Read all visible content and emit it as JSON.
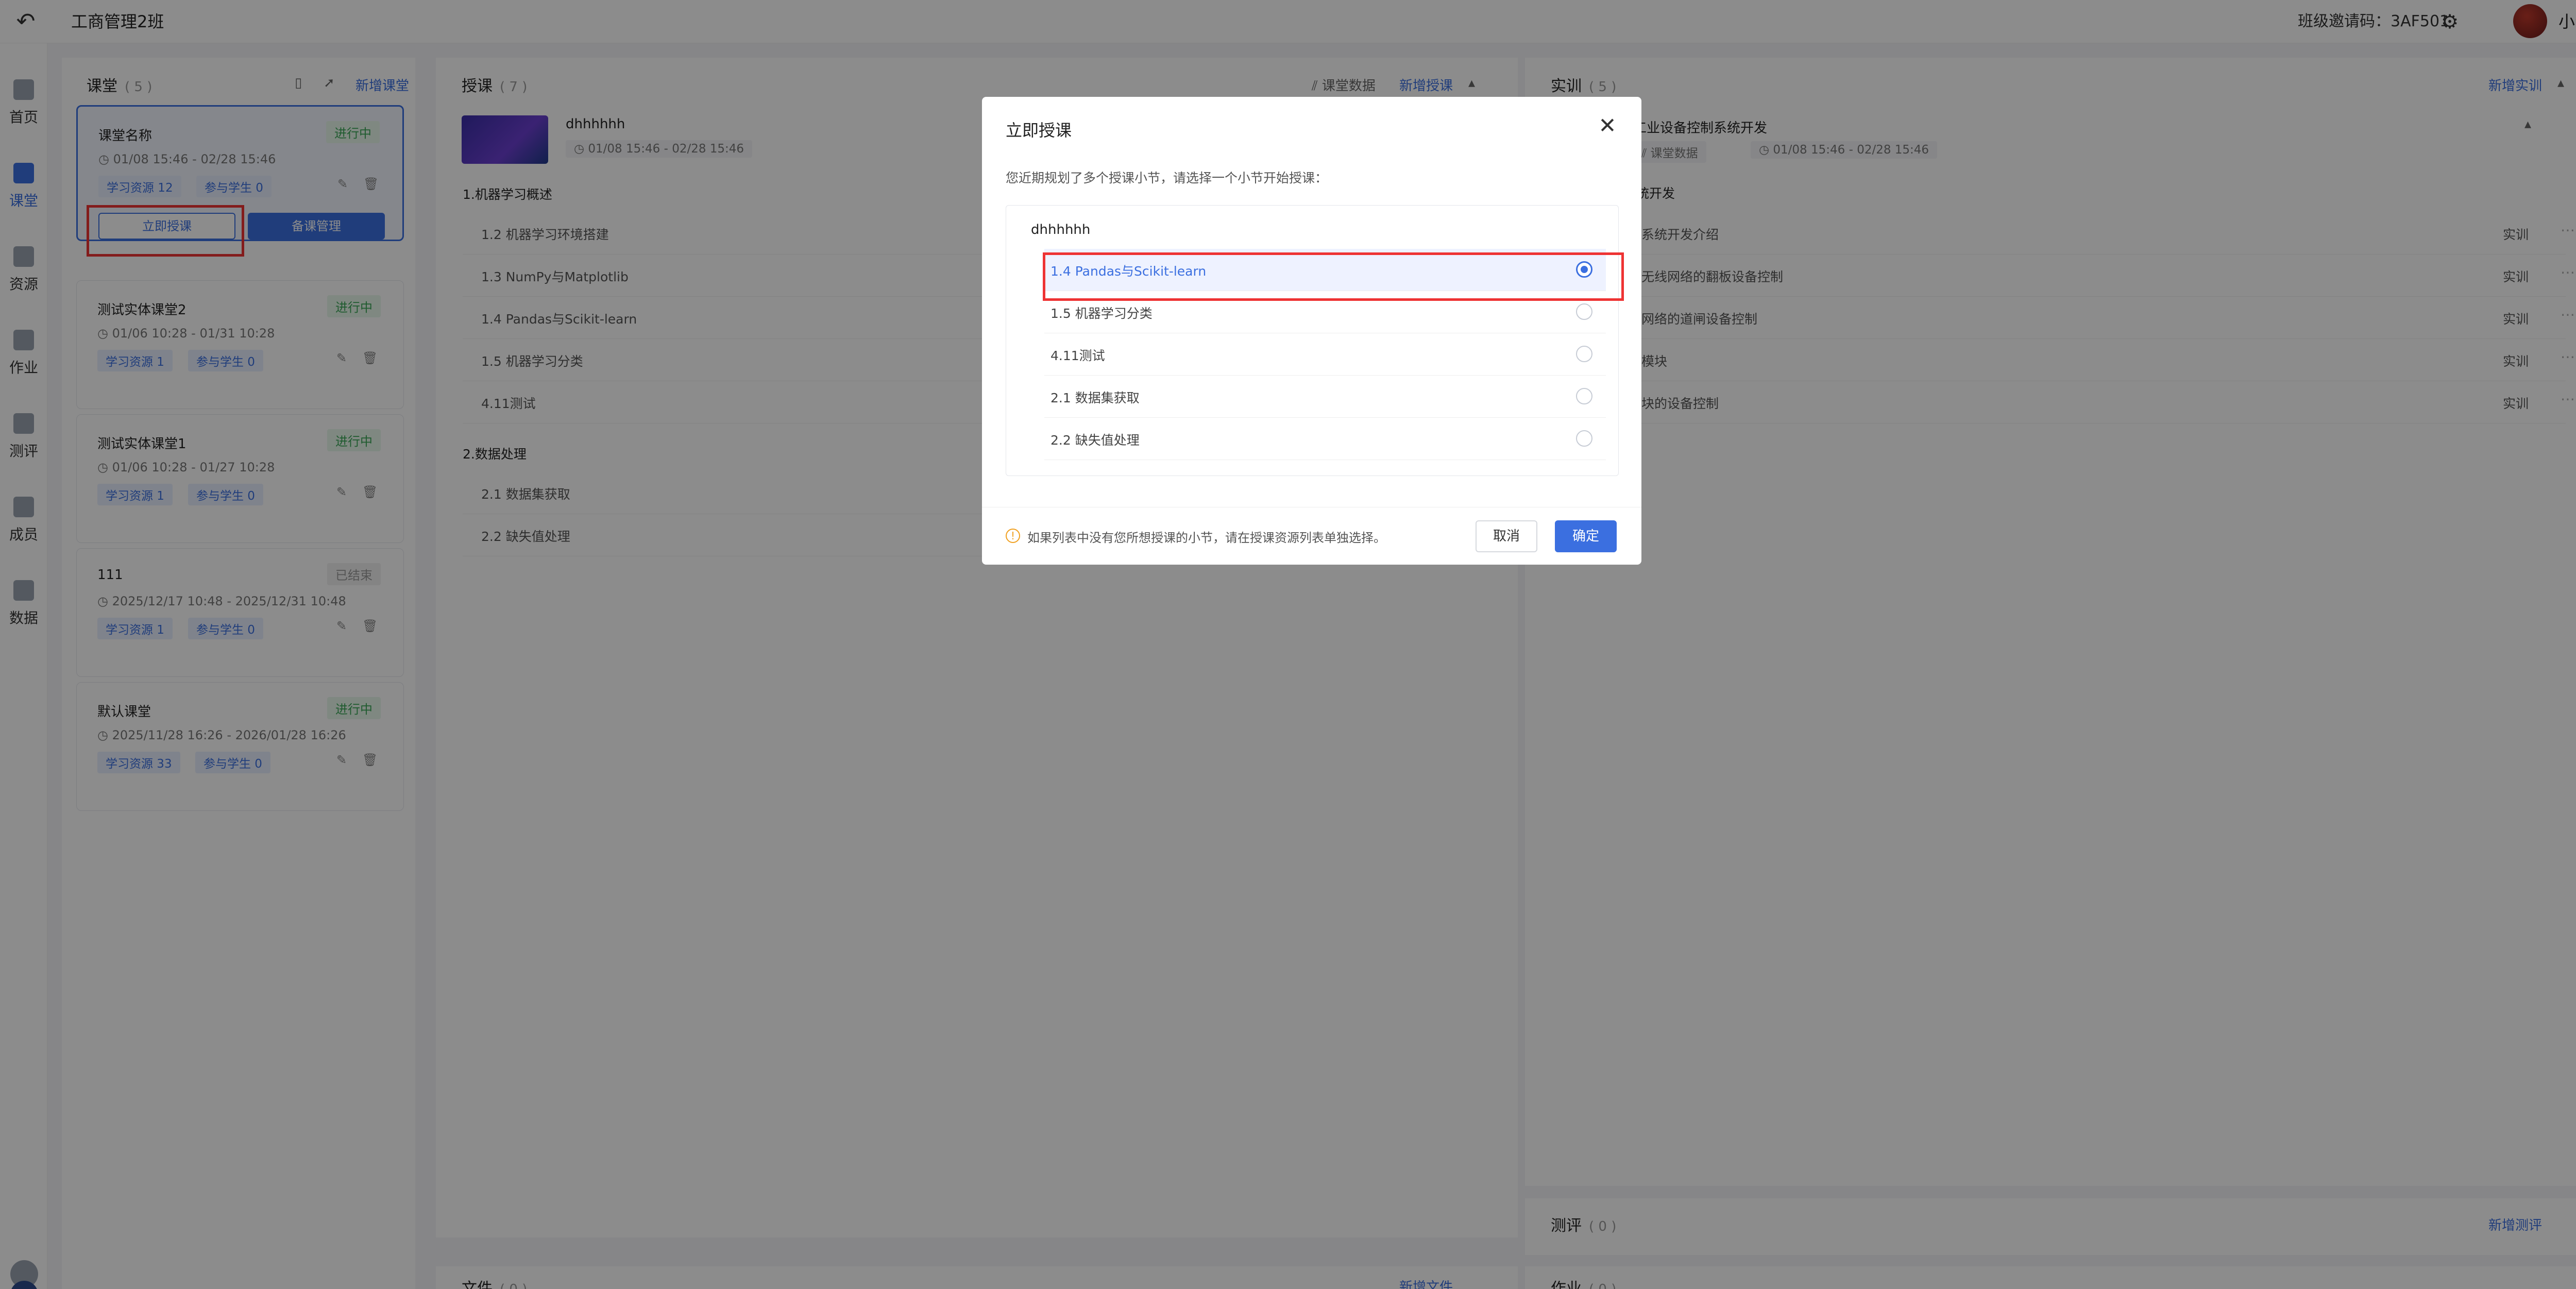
{
  "header": {
    "class_title": "工商管理2班",
    "invite_label": "班级邀请码：3AF501",
    "username": "小青椒"
  },
  "sidebar": {
    "items": [
      {
        "label": "首页",
        "icon": "home-icon"
      },
      {
        "label": "课堂",
        "icon": "classroom-icon",
        "active": true
      },
      {
        "label": "资源",
        "icon": "resource-icon"
      },
      {
        "label": "作业",
        "icon": "homework-icon"
      },
      {
        "label": "测评",
        "icon": "assessment-icon"
      },
      {
        "label": "成员",
        "icon": "members-icon"
      },
      {
        "label": "数据",
        "icon": "data-icon"
      }
    ]
  },
  "classroom_panel": {
    "title": "课堂",
    "count": "( 5 )",
    "add_label": "新增课堂",
    "cards": [
      {
        "title": "课堂名称",
        "status": "进行中",
        "time": "01/08 15:46  -  02/28 15:46",
        "resources": "学习资源  12",
        "students": "参与学生  0",
        "start_label": "立即授课",
        "prep_label": "备课管理"
      },
      {
        "title": "测试实体课堂2",
        "status": "进行中",
        "time": "01/06 10:28  -  01/31 10:28",
        "resources": "学习资源  1",
        "students": "参与学生  0"
      },
      {
        "title": "测试实体课堂1",
        "status": "进行中",
        "time": "01/06 10:28  -  01/27 10:28",
        "resources": "学习资源  1",
        "students": "参与学生  0"
      },
      {
        "title": "111",
        "status": "已结束",
        "time": "2025/12/17 10:48  -  2025/12/31 10:48",
        "resources": "学习资源  1",
        "students": "参与学生  0"
      },
      {
        "title": "默认课堂",
        "status": "进行中",
        "time": "2025/11/28 16:26  -  2026/01/28 16:26",
        "resources": "学习资源  33",
        "students": "参与学生  0"
      }
    ]
  },
  "teaching_panel": {
    "title": "授课",
    "count": "( 7 )",
    "data_label": "课堂数据",
    "add_label": "新增授课",
    "lesson_name": "dhhhhhh",
    "lesson_time": "01/08 15:46 - 02/28 15:46",
    "sections": [
      {
        "head": "1.机器学习概述",
        "items": [
          "1.2 机器学习环境搭建",
          "1.3 NumPy与Matplotlib",
          "1.4 Pandas与Scikit-learn",
          "1.5 机器学习分类",
          "4.11测试"
        ]
      },
      {
        "head": "2.数据处理",
        "items": [
          "2.1 数据集获取",
          "2.2 缺失值处理"
        ]
      }
    ]
  },
  "training_panel": {
    "title": "实训",
    "count": "( 5 )",
    "add_label": "新增实训",
    "item_title": "工业设备控制系统开发",
    "item_data_label": "课堂数据",
    "item_time": "01/08 15:46 - 02/28 15:46",
    "group": "统开发",
    "rows": [
      "系统开发介绍",
      "无线网络的翻板设备控制",
      "网络的道闸设备控制",
      "模块",
      "块的设备控制"
    ],
    "badge": "实训"
  },
  "assessment_panel": {
    "title": "测评",
    "count": "( 0 )",
    "add_label": "新增测评"
  },
  "files_panel": {
    "title": "文件",
    "count": "( 0 )",
    "add_label": "新增文件"
  },
  "homework_panel": {
    "title": "作业",
    "count": "( 0 )"
  },
  "modal": {
    "title": "立即授课",
    "description": "您近期规划了多个授课小节，请选择一个小节开始授课：",
    "group": "dhhhhhh",
    "options": [
      "1.4 Pandas与Scikit-learn",
      "1.5 机器学习分类",
      "4.11测试",
      "2.1 数据集获取",
      "2.2 缺失值处理"
    ],
    "selected_index": 0,
    "note": "如果列表中没有您所想授课的小节，请在授课资源列表单独选择。",
    "cancel_label": "取消",
    "ok_label": "确定"
  }
}
